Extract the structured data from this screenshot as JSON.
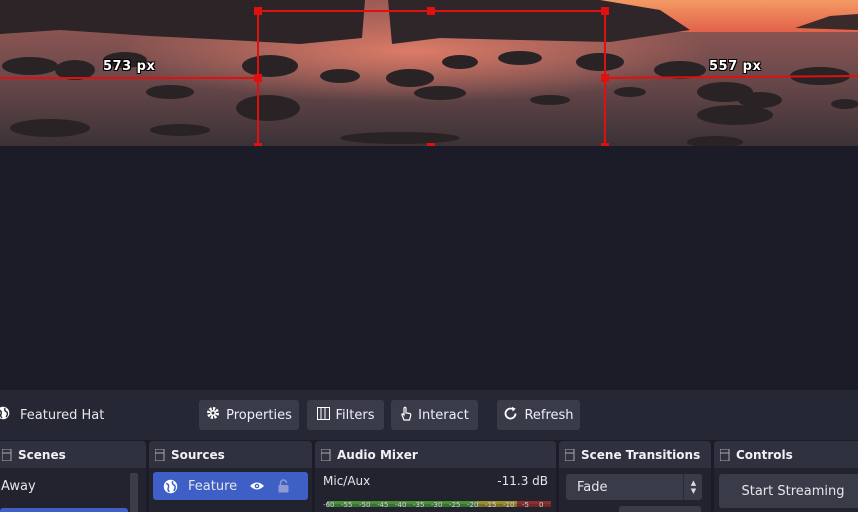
{
  "preview": {
    "left_distance_label": "573 px",
    "right_distance_label": "557 px",
    "selection_color": "#e01010"
  },
  "context_bar": {
    "source_name": "Featured Hat",
    "buttons": {
      "properties": "Properties",
      "filters": "Filters",
      "interact": "Interact",
      "refresh": "Refresh"
    }
  },
  "docks": {
    "scenes": {
      "title": "Scenes",
      "items": [
        "Away"
      ]
    },
    "sources": {
      "title": "Sources",
      "items": [
        {
          "name": "Feature",
          "icon": "globe-icon",
          "visible": true,
          "locked": false
        }
      ]
    },
    "audio_mixer": {
      "title": "Audio Mixer",
      "channel": "Mic/Aux",
      "level": "-11.3 dB",
      "scale": [
        "-60",
        "-55",
        "-50",
        "-45",
        "-40",
        "-35",
        "-30",
        "-25",
        "-20",
        "-15",
        "-10",
        "-5",
        "0"
      ]
    },
    "scene_transitions": {
      "title": "Scene Transitions",
      "selected": "Fade"
    },
    "controls": {
      "title": "Controls",
      "start_streaming": "Start Streaming"
    }
  },
  "colors": {
    "accent": "#3e5fc6",
    "panel": "#2a2b38",
    "background": "#1b1c27"
  }
}
